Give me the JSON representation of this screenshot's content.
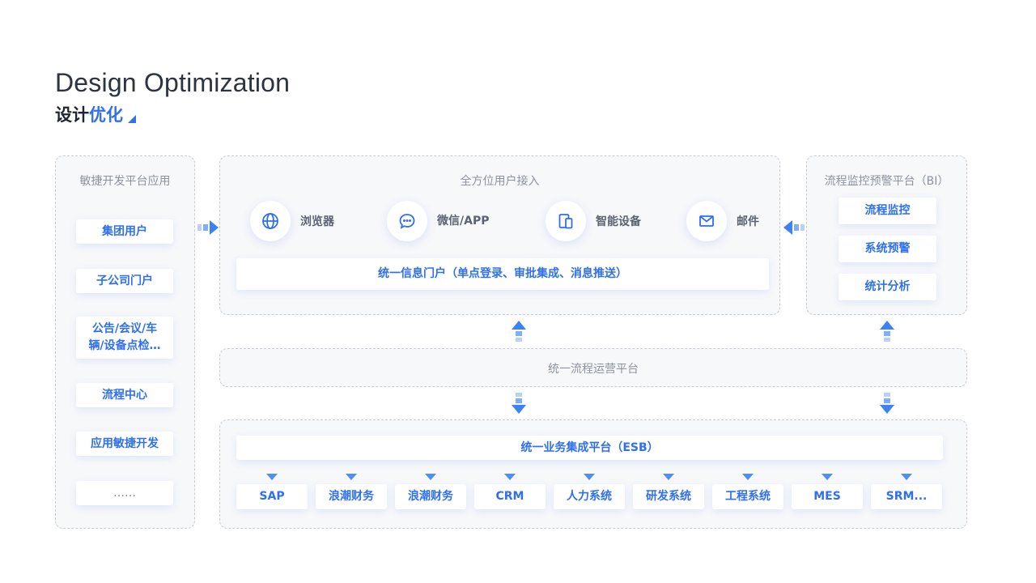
{
  "heading": {
    "title_en": "Design Optimization",
    "title_cn_prefix": "设计",
    "title_cn_accent": "优化"
  },
  "left_panel": {
    "title": "敏捷开发平台应用",
    "items": [
      "集团用户",
      "子公司门户",
      "公告/会议/车辆/设备点检…",
      "流程中心",
      "应用敏捷开发",
      "……"
    ]
  },
  "access_panel": {
    "title": "全方位用户接入",
    "channels": [
      {
        "icon": "globe-icon",
        "label": "浏览器"
      },
      {
        "icon": "chat-icon",
        "label": "微信/APP"
      },
      {
        "icon": "device-icon",
        "label": "智能设备"
      },
      {
        "icon": "mail-icon",
        "label": "邮件"
      }
    ],
    "portal": "统一信息门户（单点登录、审批集成、消息推送）"
  },
  "bi_panel": {
    "title": "流程监控预警平台（BI）",
    "items": [
      "流程监控",
      "系统预警",
      "统计分析"
    ]
  },
  "process_platform": {
    "title": "统一流程运营平台"
  },
  "esb_panel": {
    "title": "统一业务集成平台（ESB）",
    "systems": [
      "SAP",
      "浪潮财务",
      "浪潮财务",
      "CRM",
      "人力系统",
      "研发系统",
      "工程系统",
      "MES",
      "SRM..."
    ]
  },
  "colors": {
    "accent": "#2f6ff0",
    "arrow": "#4f8ef7",
    "panel_bg": "#f7f8fa",
    "panel_border": "#c9ccd3"
  }
}
